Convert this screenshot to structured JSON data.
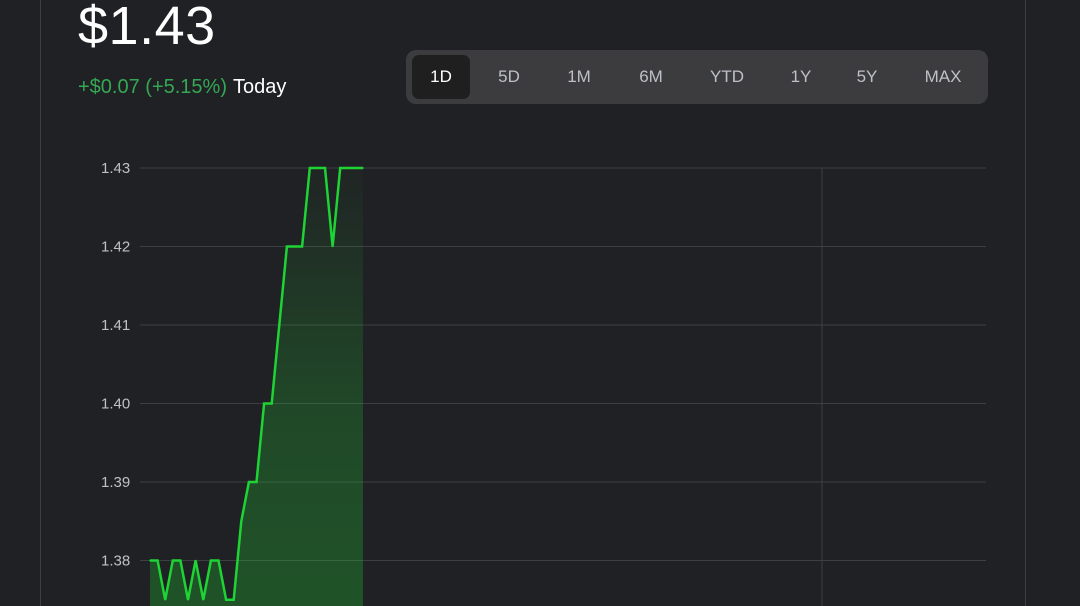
{
  "quote": {
    "price": "$1.43",
    "change": "+$0.07 (+5.15%)",
    "period": "Today"
  },
  "ranges": {
    "selected": "1D",
    "items": [
      "1D",
      "5D",
      "1M",
      "6M",
      "YTD",
      "1Y",
      "5Y",
      "MAX"
    ]
  },
  "colors": {
    "line": "#1ed334",
    "positive_text": "#34a853",
    "grid": "#3c4043",
    "background": "#202124"
  },
  "chart_data": {
    "type": "area",
    "grid": true,
    "y_ticks": [
      "1.43",
      "1.42",
      "1.41",
      "1.40",
      "1.39",
      "1.38"
    ],
    "ylim": [
      1.37,
      1.43
    ],
    "series": [
      {
        "values": [
          1.38,
          1.38,
          1.375,
          1.38,
          1.38,
          1.375,
          1.38,
          1.375,
          1.38,
          1.38,
          1.375,
          1.375,
          1.385,
          1.39,
          1.39,
          1.4,
          1.4,
          1.41,
          1.42,
          1.42,
          1.42,
          1.43,
          1.43,
          1.43,
          1.42,
          1.43,
          1.43,
          1.43,
          1.43
        ]
      }
    ]
  }
}
